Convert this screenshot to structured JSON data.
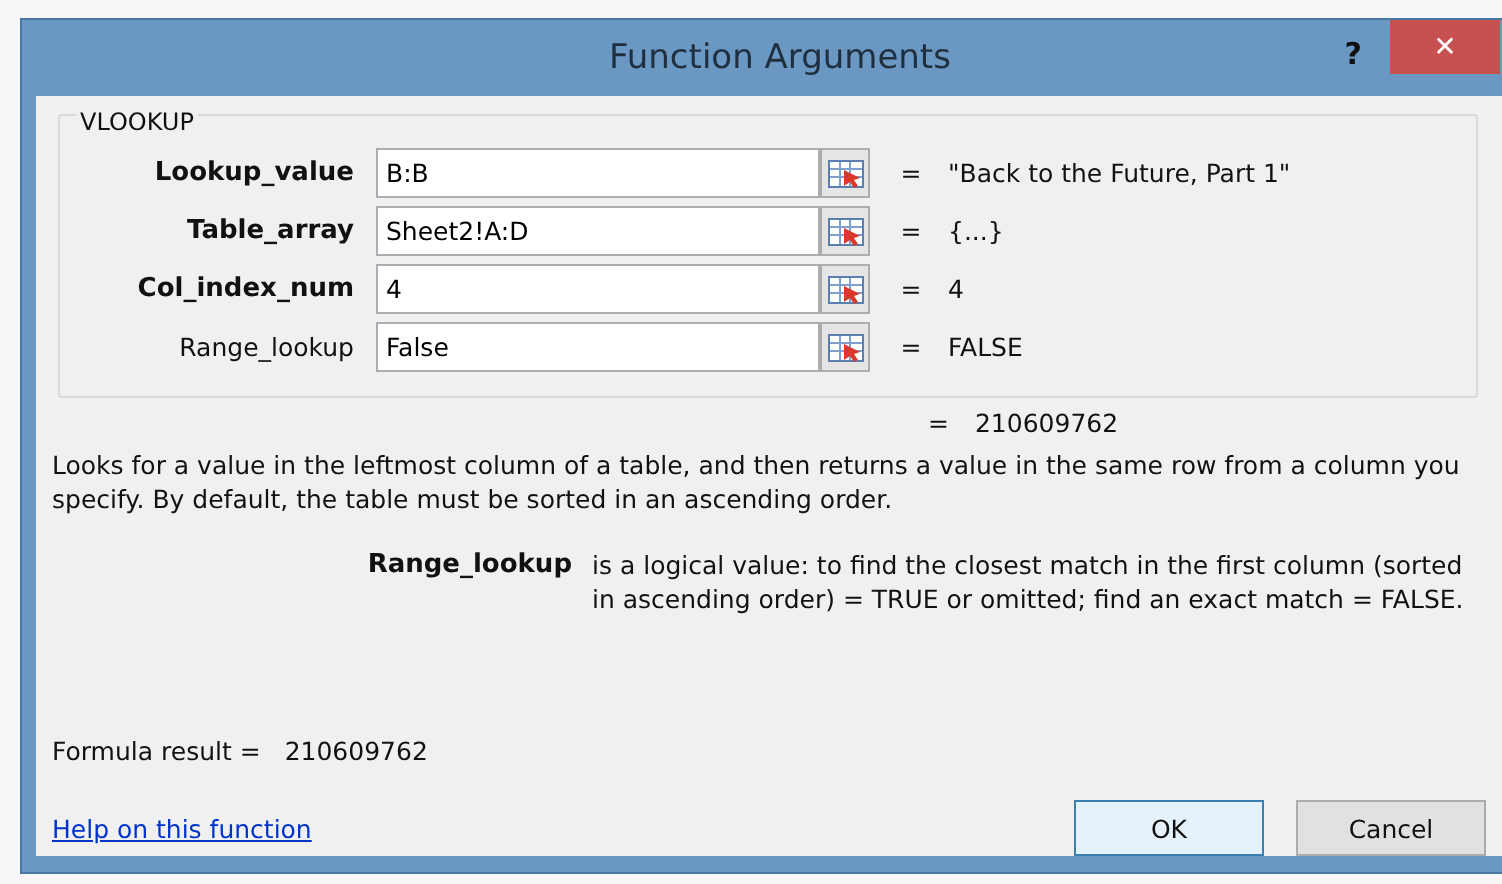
{
  "window": {
    "title": "Function Arguments",
    "help_glyph": "?",
    "close_glyph": "✕"
  },
  "function": {
    "name": "VLOOKUP",
    "arguments": [
      {
        "label": "Lookup_value",
        "required": true,
        "value": "B:B",
        "equals": "=",
        "result": "\"Back to the Future, Part 1\""
      },
      {
        "label": "Table_array",
        "required": true,
        "value": "Sheet2!A:D",
        "equals": "=",
        "result": "{...}"
      },
      {
        "label": "Col_index_num",
        "required": true,
        "value": "4",
        "equals": "=",
        "result": "4"
      },
      {
        "label": "Range_lookup",
        "required": false,
        "value": "False",
        "equals": "=",
        "result": "FALSE"
      }
    ],
    "result_equals": "=",
    "result": "210609762",
    "description": "Looks for a value in the leftmost column of a table, and then returns a value in the same row from a column you specify. By default, the table must be sorted in an ascending order.",
    "argument_help": {
      "label": "Range_lookup",
      "text": "is a logical value: to find the closest match in the first column (sorted in ascending order) = TRUE or omitted; find an exact match = FALSE."
    }
  },
  "formula_result": {
    "label": "Formula result =",
    "value": "210609762"
  },
  "help_link": "Help on this function",
  "buttons": [
    {
      "label": "OK",
      "default": true
    },
    {
      "label": "Cancel",
      "default": false
    }
  ]
}
